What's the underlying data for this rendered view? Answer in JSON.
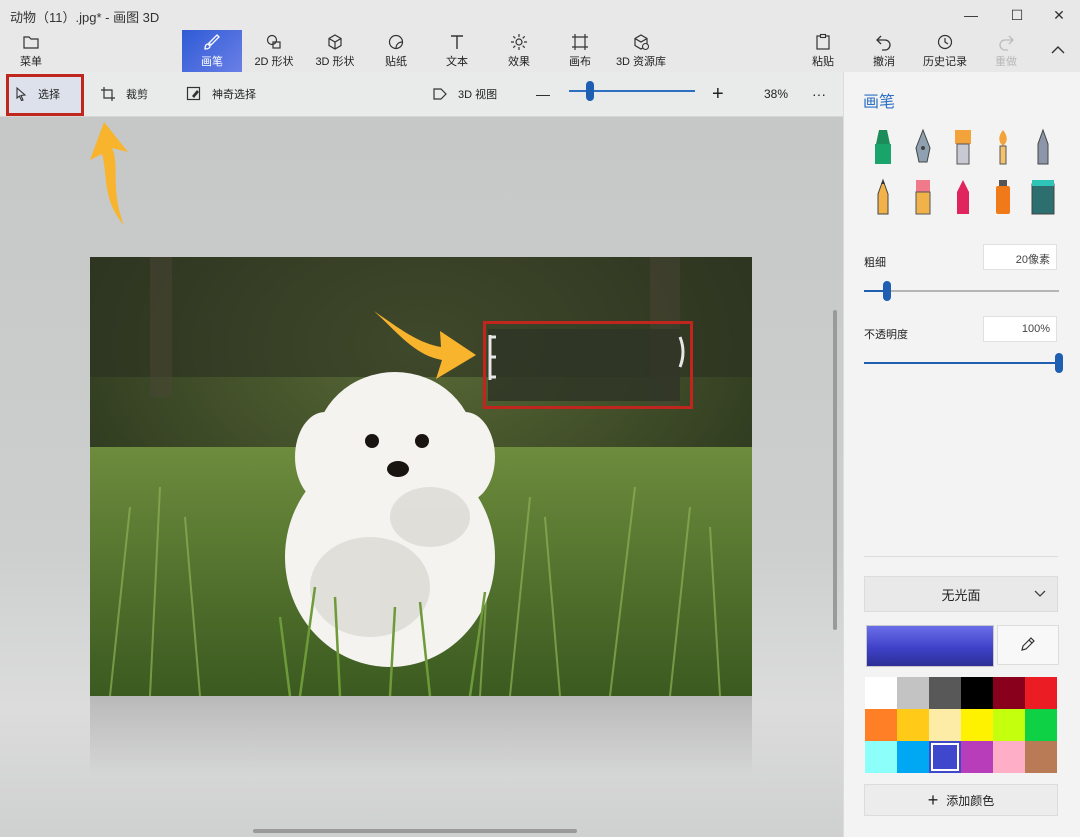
{
  "window": {
    "title": "动物（11）.jpg* - 画图 3D",
    "controls": {
      "minimize": "—",
      "maximize": "☐",
      "close": "✕"
    }
  },
  "ribbon": {
    "menu_label": "菜单",
    "tabs": [
      {
        "label": "画笔",
        "icon": "brush-icon",
        "active": true
      },
      {
        "label": "2D 形状",
        "icon": "2d-shapes-icon"
      },
      {
        "label": "3D 形状",
        "icon": "3d-shapes-icon"
      },
      {
        "label": "贴纸",
        "icon": "sticker-icon"
      },
      {
        "label": "文本",
        "icon": "text-icon"
      },
      {
        "label": "效果",
        "icon": "effects-icon"
      },
      {
        "label": "画布",
        "icon": "canvas-icon"
      },
      {
        "label": "3D 资源库",
        "icon": "3d-library-icon"
      }
    ],
    "right": [
      {
        "label": "粘贴",
        "icon": "paste-icon"
      },
      {
        "label": "撤消",
        "icon": "undo-icon"
      },
      {
        "label": "历史记录",
        "icon": "history-icon"
      },
      {
        "label": "重做",
        "icon": "redo-icon",
        "disabled": true
      }
    ]
  },
  "toolbar": {
    "select_label": "选择",
    "crop_label": "裁剪",
    "magic_select_label": "神奇选择",
    "view3d_label": "3D 视图",
    "zoom_minus": "—",
    "zoom_plus": "+",
    "zoom_value": "38%",
    "zoom_level": 0.17,
    "more": "···"
  },
  "panel": {
    "title": "画笔",
    "thickness_label": "粗细",
    "thickness_value": "20像素",
    "thickness_level": 0.12,
    "opacity_label": "不透明度",
    "opacity_value": "100%",
    "opacity_level": 1.0,
    "finish_value": "无光面",
    "current_color": "#3f42c8",
    "add_color_label": "添加颜色",
    "palette": [
      "#ffffff",
      "#c3c3c3",
      "#585858",
      "#000000",
      "#88001b",
      "#ec1c24",
      "#ff7f27",
      "#ffca18",
      "#fdeca6",
      "#fff200",
      "#c4ff0e",
      "#0ed145",
      "#8cfffb",
      "#00a8f3",
      "#3f48cc",
      "#b83dba",
      "#ffaec8",
      "#b97a56"
    ],
    "selected_swatch": 14
  },
  "colors": {
    "accent": "#2c6fc4",
    "highlight_box": "#c0251e",
    "arrow": "#f7b42c"
  }
}
